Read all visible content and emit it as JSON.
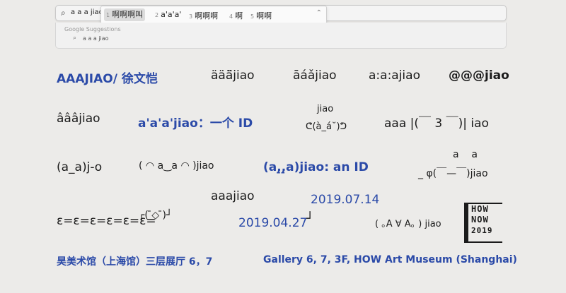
{
  "search": {
    "query": "a a a jiao",
    "icon": "search-icon"
  },
  "ime": {
    "candidates": [
      {
        "num": "1",
        "text": "啊啊啊叫"
      },
      {
        "num": "2",
        "text": "a'a'a'"
      },
      {
        "num": "3",
        "text": "啊啊啊"
      },
      {
        "num": "4",
        "text": "啊"
      },
      {
        "num": "5",
        "text": "啊啊"
      }
    ],
    "selected_index": 0
  },
  "suggestions": {
    "header": "Google Suggestions",
    "items": [
      "a a a jiao"
    ]
  },
  "poster": {
    "r1": {
      "name": "AAAJIAO/ 徐文恺",
      "v1": "äää̈jiao",
      "v2": "āáǎjiao",
      "v3": "a:a:ajiao",
      "v4": "@@@jiao"
    },
    "r2": {
      "v1": "âââjiao",
      "id_line": "a'a'a'jiao：一个 ID",
      "face_top": "jiao",
      "face": "ᕦ(à_á˘)ᕤ",
      "v3": "aaa |(￣ 3 ￣)| iao"
    },
    "r3": {
      "v1": "(a_a)j-o",
      "v2": "( ◠ a‿a ◠ )jiao",
      "id_line": "(a,̠,̠a)jiao: an ID",
      "v3_top": "a    a",
      "v3": "_ φ(￣—￣)jiao"
    },
    "r4": {
      "v1": "aaajiao",
      "date1": "2019.07.14"
    },
    "r5": {
      "v1": "ε=ε=ε=ε=ε=ε=",
      "v2": "┌( ̄◇ ̄)┘",
      "date2": "2019.04.27",
      "date2_mark": "┘",
      "v3": "( ｡A ∀ A｡ ) jiao"
    },
    "logo": {
      "line1": "HOW",
      "line2": "NOW",
      "line3": "2019"
    },
    "footer": {
      "venue_cn": "昊美术馆（上海馆）三层展厅 6，7",
      "venue_en": "Gallery 6, 7, 3F, HOW Art Museum (Shanghai)"
    },
    "accent_color": "#2b4aa8"
  }
}
